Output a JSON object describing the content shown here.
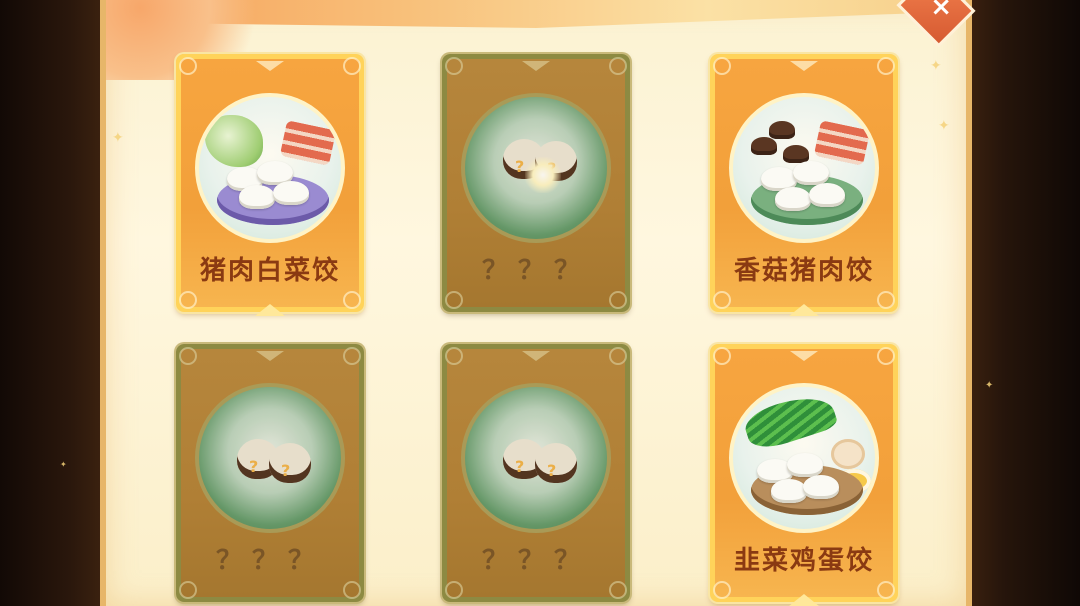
{
  "cards": [
    {
      "status": "unlocked",
      "label": "猪肉白菜饺",
      "icon": "cabbage-pork-dumplings-icon"
    },
    {
      "status": "locked",
      "label": "？？？",
      "icon": "mystery-dumpling-icon"
    },
    {
      "status": "unlocked",
      "label": "香菇猪肉饺",
      "icon": "mushroom-pork-dumplings-icon"
    },
    {
      "status": "locked",
      "label": "？？？",
      "icon": "mystery-dumpling-icon"
    },
    {
      "status": "locked",
      "label": "？？？",
      "icon": "mystery-dumpling-icon"
    },
    {
      "status": "unlocked",
      "label": "韭菜鸡蛋饺",
      "icon": "chive-egg-dumplings-icon"
    }
  ],
  "mystery_mark": "?",
  "close_mark": "×",
  "colors": {
    "card_unlocked": "#f2a03a",
    "card_locked": "#b07f35",
    "label_unlocked": "#8a3a12",
    "label_locked": "#7a5526",
    "panel_bg": "#fff7df"
  }
}
